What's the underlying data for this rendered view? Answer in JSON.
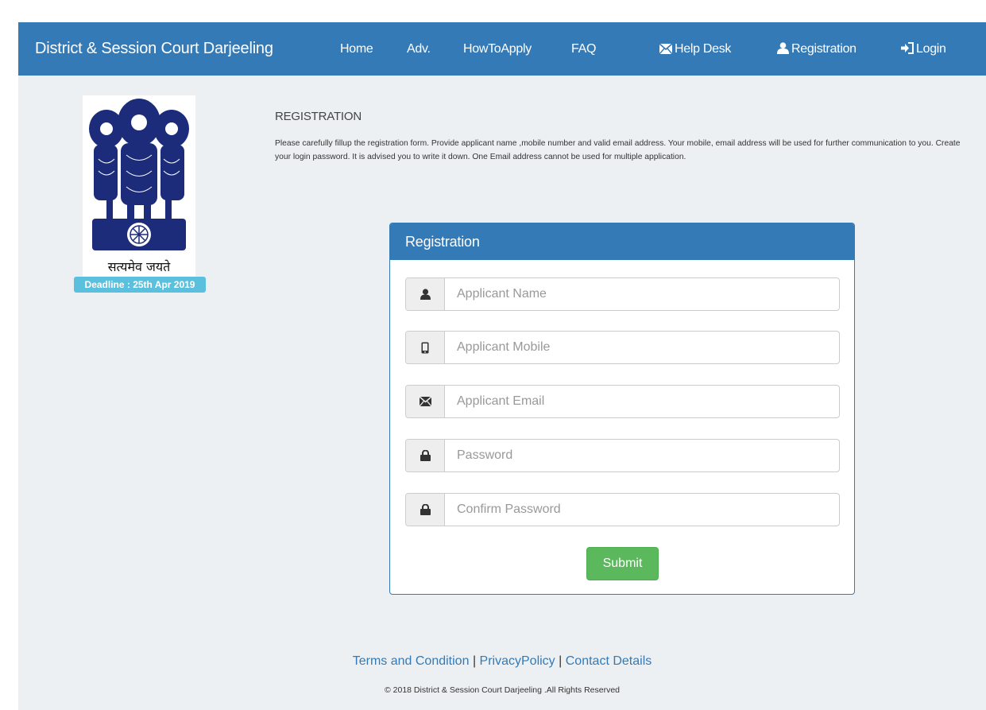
{
  "nav": {
    "brand": "District & Session Court Darjeeling",
    "home": "Home",
    "adv": "Adv.",
    "how_to_apply": "HowToApply",
    "faq": "FAQ",
    "help_desk": "Help Desk",
    "registration": "Registration",
    "login": "Login"
  },
  "sidebar": {
    "emblem_text": "सत्यमेव जयते",
    "deadline": "Deadline : 25th Apr 2019"
  },
  "intro": {
    "heading": "REGISTRATION",
    "description": "Please carefully fillup the registration form. Provide applicant name ,mobile number and valid email address. Your mobile, email address will be used for further communication to you. Create your login password. It is advised you to write it down. One Email address cannot be used for multiple application."
  },
  "form": {
    "title": "Registration",
    "fields": [
      {
        "placeholder": "Applicant Name",
        "value": "",
        "icon": "user-icon"
      },
      {
        "placeholder": "Applicant Mobile",
        "value": "",
        "icon": "mobile-icon"
      },
      {
        "placeholder": "Applicant Email",
        "value": "",
        "icon": "envelope-icon"
      },
      {
        "placeholder": "Password",
        "value": "",
        "icon": "lock-icon"
      },
      {
        "placeholder": "Confirm Password",
        "value": "",
        "icon": "lock-icon"
      }
    ],
    "submit": "Submit"
  },
  "footer": {
    "terms": "Terms and Condition",
    "privacy": "PrivacyPolicy",
    "contact": "Contact Details",
    "separator": "|",
    "copyright": "© 2018 District & Session Court Darjeeling .All Rights Reserved"
  },
  "colors": {
    "primary": "#347ab6",
    "success": "#5cb85c",
    "info": "#5bc0de",
    "background": "#edf0f2"
  }
}
